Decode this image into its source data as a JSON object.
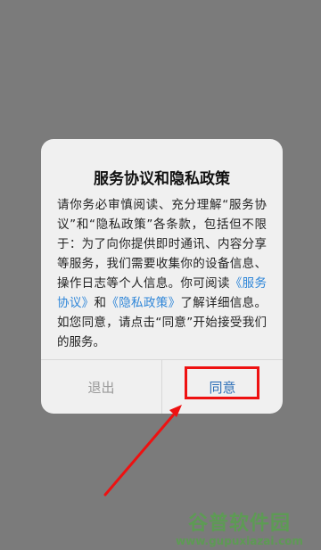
{
  "dialog": {
    "title": "服务协议和隐私政策",
    "body_pre": "请你务必审慎阅读、充分理解“服务协议”和“隐私政策”各条款，包括但不限于：为了向你提供即时通讯、内容分享等服务，我们需要收集你的设备信息、操作日志等个人信息。你可阅读",
    "link_service": "《服务协议》",
    "body_and": "和",
    "link_privacy": "《隐私政策》",
    "body_post": "了解详细信息。如您同意，请点击“同意”开始接受我们的服务。",
    "exit_label": "退出",
    "agree_label": "同意"
  },
  "watermark": {
    "text": "谷普软件园",
    "url": "www.gupuxiazai.com"
  },
  "colors": {
    "background": "#7b7b7b",
    "dialog_bg": "#f0f0f0",
    "link": "#2f86d8",
    "agree": "#2d6fb7",
    "exit": "#9a9a9a",
    "highlight": "#e11",
    "watermark": "#5d9b54"
  }
}
